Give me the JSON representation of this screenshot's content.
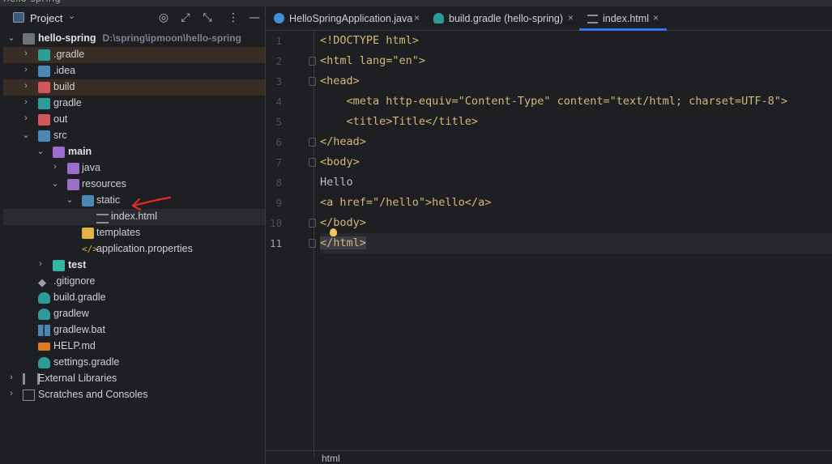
{
  "window": {
    "title_fragment": "hello-spring"
  },
  "project_panel": {
    "title": "Project",
    "tree": [
      {
        "label": "hello-spring",
        "path": "D:\\spring\\ipmoon\\hello-spring",
        "icon": "folder-module-icon",
        "bold": true
      },
      {
        "label": ".gradle",
        "icon": "folder-icon"
      },
      {
        "label": ".idea",
        "icon": "folder-icon"
      },
      {
        "label": "build",
        "icon": "folder-excluded-icon"
      },
      {
        "label": "gradle",
        "icon": "folder-icon"
      },
      {
        "label": "out",
        "icon": "folder-excluded-icon"
      },
      {
        "label": "src",
        "icon": "folder-source-icon"
      },
      {
        "label": "main",
        "icon": "folder-icon",
        "bold": true
      },
      {
        "label": "java",
        "icon": "folder-source-icon"
      },
      {
        "label": "resources",
        "icon": "folder-resources-icon"
      },
      {
        "label": "static",
        "icon": "folder-web-icon"
      },
      {
        "label": "index.html",
        "icon": "html-file-icon"
      },
      {
        "label": "templates",
        "icon": "folder-icon"
      },
      {
        "label": "application.properties",
        "icon": "properties-file-icon"
      },
      {
        "label": "test",
        "icon": "folder-test-icon",
        "bold": true
      },
      {
        "label": ".gitignore",
        "icon": "gitignore-icon"
      },
      {
        "label": "build.gradle",
        "icon": "gradle-icon"
      },
      {
        "label": "gradlew",
        "icon": "gradle-icon"
      },
      {
        "label": "gradlew.bat",
        "icon": "windows-icon"
      },
      {
        "label": "HELP.md",
        "icon": "markdown-icon"
      },
      {
        "label": "settings.gradle",
        "icon": "gradle-icon"
      },
      {
        "label": "External Libraries",
        "icon": "library-icon"
      },
      {
        "label": "Scratches and Consoles",
        "icon": "scratches-icon"
      }
    ]
  },
  "tabs": [
    {
      "label": "HelloSpringApplication.java",
      "icon": "java-class-icon"
    },
    {
      "label": "build.gradle (hello-spring)",
      "icon": "gradle-icon"
    },
    {
      "label": "index.html",
      "icon": "html-file-icon",
      "active": true
    }
  ],
  "editor": {
    "line_numbers": [
      "1",
      "2",
      "3",
      "4",
      "5",
      "6",
      "7",
      "8",
      "9",
      "10",
      "11"
    ],
    "lines": [
      "<!DOCTYPE html>",
      "<html lang=\"en\">",
      "<head>",
      "    <meta http-equiv=\"Content-Type\" content=\"text/html; charset=UTF-8\">",
      "    <title>Title</title>",
      "</head>",
      "<body>",
      "Hello",
      "<a href=\"/hello\">hello</a>",
      "</body>",
      "</html>"
    ],
    "current_line": 11
  },
  "statusbar": {
    "breadcrumb": "html"
  },
  "colors": {
    "accent": "#3574f0",
    "annotation": "#e02b20"
  }
}
